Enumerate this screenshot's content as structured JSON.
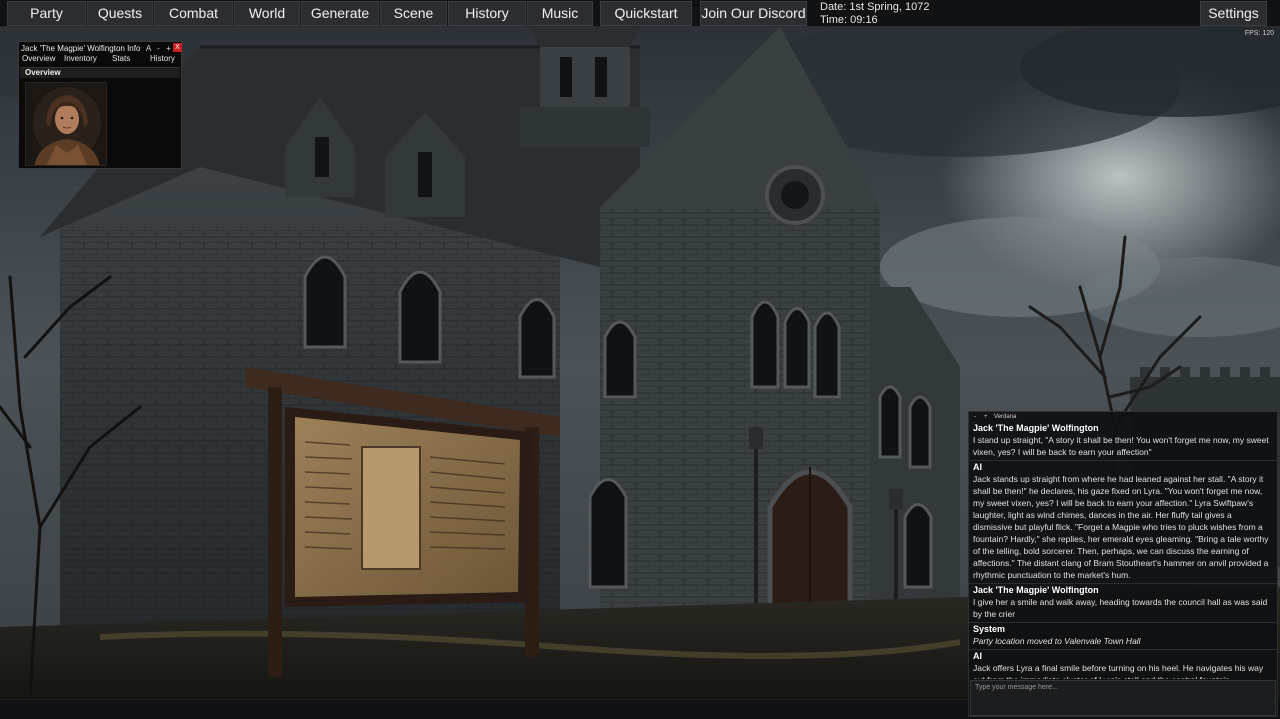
{
  "nav": {
    "party": "Party",
    "quests": "Quests",
    "combat": "Combat",
    "world": "World",
    "generate": "Generate",
    "scene": "Scene",
    "history": "History",
    "music": "Music",
    "quickstart": "Quickstart",
    "discord": "Join Our Discord",
    "settings": "Settings"
  },
  "clock": {
    "date": "Date: 1st Spring, 1072",
    "time": "Time: 09:16"
  },
  "fps": "FPS: 120",
  "info_window": {
    "title": "Jack 'The Magpie' Wolfington Info",
    "controls": {
      "font": "A",
      "minimize": "-",
      "maximize": "+",
      "close": "X"
    },
    "tabs": [
      "Overview",
      "Inventory",
      "Stats",
      "History"
    ],
    "section": "Overview"
  },
  "chat": {
    "toolbar": {
      "minus": "-",
      "plus": "+",
      "font": "Verdana"
    },
    "messages": [
      {
        "author": "Jack 'The Magpie' Wolfington",
        "type": "player",
        "text": "I stand up straight, \"A story it shall be then! You won't forget me now, my sweet vixen, yes? I will be back to earn your affection\""
      },
      {
        "author": "AI",
        "type": "ai",
        "text": "Jack stands up straight from where he had leaned against her stall. \"A story it shall be then!\" he declares, his gaze fixed on Lyra. \"You won't forget me now, my sweet vixen, yes? I will be back to earn your affection.\" Lyra Swiftpaw's laughter, light as wind chimes, dances in the air. Her fluffy tail gives a dismissive but playful flick. \"Forget a Magpie who tries to pluck wishes from a fountain? Hardly,\" she replies, her emerald eyes gleaming. \"Bring a tale worthy of the telling, bold sorcerer. Then, perhaps, we can discuss the earning of affections.\" The distant clang of Bram Stoutheart's hammer on anvil provided a rhythmic punctuation to the market's hum."
      },
      {
        "author": "Jack 'The Magpie' Wolfington",
        "type": "player",
        "text": "I give her a smile and walk away, heading towards the council hall as was said by the crier"
      },
      {
        "author": "System",
        "type": "system",
        "text": "Party location moved to Valenvale Town Hall"
      },
      {
        "author": "AI",
        "type": "ai",
        "text": "Jack offers Lyra a final smile before turning on his heel. He navigates his way out from the immediate cluster of Lyra's stall and the central fountain,"
      }
    ],
    "input_placeholder": "Type your message here..."
  },
  "colors": {
    "topbar_bg": "#111213",
    "button_bg": "#2b2d30",
    "close_red": "#c82020",
    "chat_bg": "#0e1012"
  }
}
